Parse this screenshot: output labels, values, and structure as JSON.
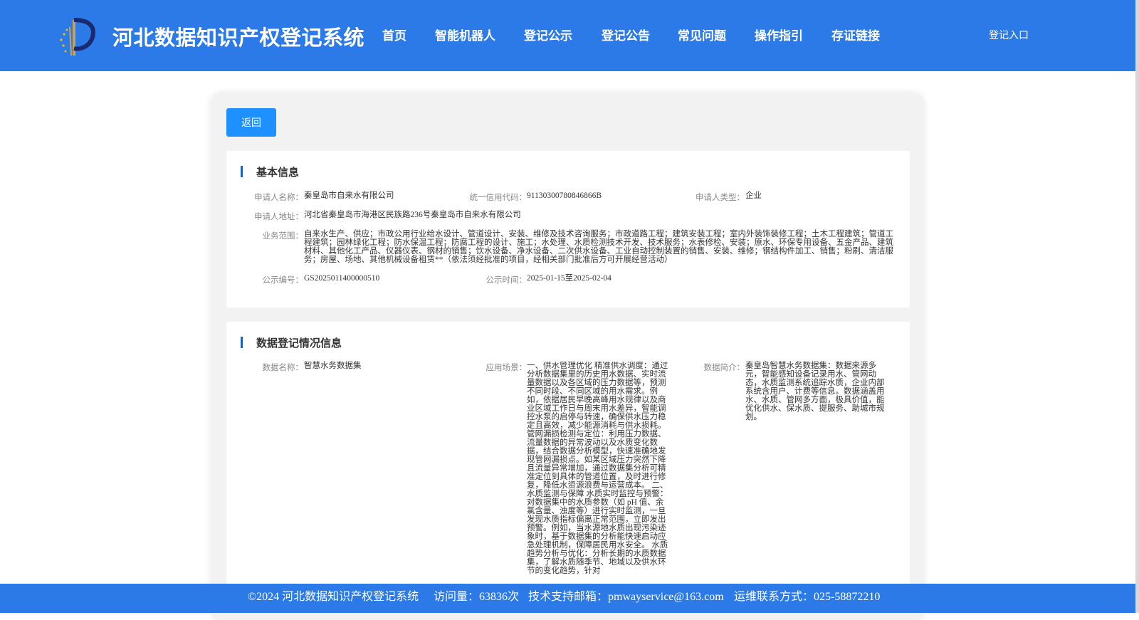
{
  "header": {
    "site_title": "河北数据知识产权登记系统",
    "nav": [
      "首页",
      "智能机器人",
      "登记公示",
      "登记公告",
      "常见问题",
      "操作指引",
      "存证链接"
    ],
    "login": "登记入口"
  },
  "colors": {
    "primary": "#2b7ae8",
    "button": "#1e90ff",
    "accent_bar": "#1e5fbf"
  },
  "back_button": "返回",
  "basic_info": {
    "title": "基本信息",
    "applicant_name_label": "申请人名称：",
    "applicant_name": "秦皇岛市自来水有限公司",
    "credit_code_label": "统一信用代码：",
    "credit_code": "91130300780846866B",
    "applicant_type_label": "申请人类型：",
    "applicant_type": "企业",
    "address_label": "申请人地址：",
    "address": "河北省秦皇岛市海港区民族路236号秦皇岛市自来水有限公司",
    "scope_label": "业务范围：",
    "scope": "自来水生产、供应；市政公用行业给水设计、管道设计、安装、维修及技术咨询服务；市政道路工程；建筑安装工程；室内外装饰装修工程；土木工程建筑；管道工程建筑；园林绿化工程；防水保温工程；防腐工程的设计、施工；水处理、水质检测技术开发、技术服务；水表修检、安装；原水、环保专用设备、五金产品、建筑材料、其他化工产品、仪器仪表、钢材的销售；饮水设备、净水设备、二次供水设备、工业自动控制装置的销售、安装、维修；钢结构件加工、销售；粉刷、清洁服务；房屋、场地、其他机械设备租赁**（依法须经批准的项目，经相关部门批准后方可开展经营活动）",
    "notice_no_label": "公示编号：",
    "notice_no": "GS2025011400000510",
    "notice_time_label": "公示时间：",
    "notice_time": "2025-01-15至2025-02-04"
  },
  "data_info": {
    "title": "数据登记情况信息",
    "data_name_label": "数据名称：",
    "data_name": "智慧水务数据集",
    "scenario_label": "应用场景：",
    "scenario": "一、供水管理优化 精准供水调度：通过分析数据集里的历史用水数据、实时流量数据以及各区域的压力数据等，预测不同时段、不同区域的用水需求。例如，依据居民早晚高峰用水规律以及商业区域工作日与周末用水差异，智能调控水泵的启停与转速，确保供水压力稳定且高效，减少能源消耗与供水损耗。 管网漏损检测与定位：利用压力数据、流量数据的异常波动以及水质变化数据，结合数据分析模型，快速准确地发现管网漏损点。如某区域压力突然下降且流量异常增加，通过数据集分析可精准定位到具体的管道位置，及时进行修复，降低水资源浪费与运营成本。 二、水质监测与保障 水质实时监控与预警：对数据集中的水质参数（如 pH 值、余氯含量、浊度等）进行实时监测，一旦发现水质指标偏离正常范围，立即发出预警。例如，当水源地水质出现污染迹象时，基于数据集的分析能快速启动应急处理机制，保障居民用水安全。 水质趋势分析与优化：分析长期的水质数据集，了解水质随季节、地域以及供水环节的变化趋势，针对",
    "intro_label": "数据简介：",
    "intro": "秦皇岛智慧水务数据集：数据来源多元，智能感知设备记录用水、管网动态，水质监测系统追踪水质，企业内部系统含用户、计费等信息。数据涵盖用水、水质、管网多方面，极具价值，能优化供水、保水质、提服务、助城市规划。"
  },
  "footer": {
    "copyright": "©2024 河北数据知识产权登记系统",
    "visits": "访问量：63836次",
    "email": "技术支持邮箱：pmwayservice@163.com",
    "phone": "运维联系方式：025-58872210"
  }
}
